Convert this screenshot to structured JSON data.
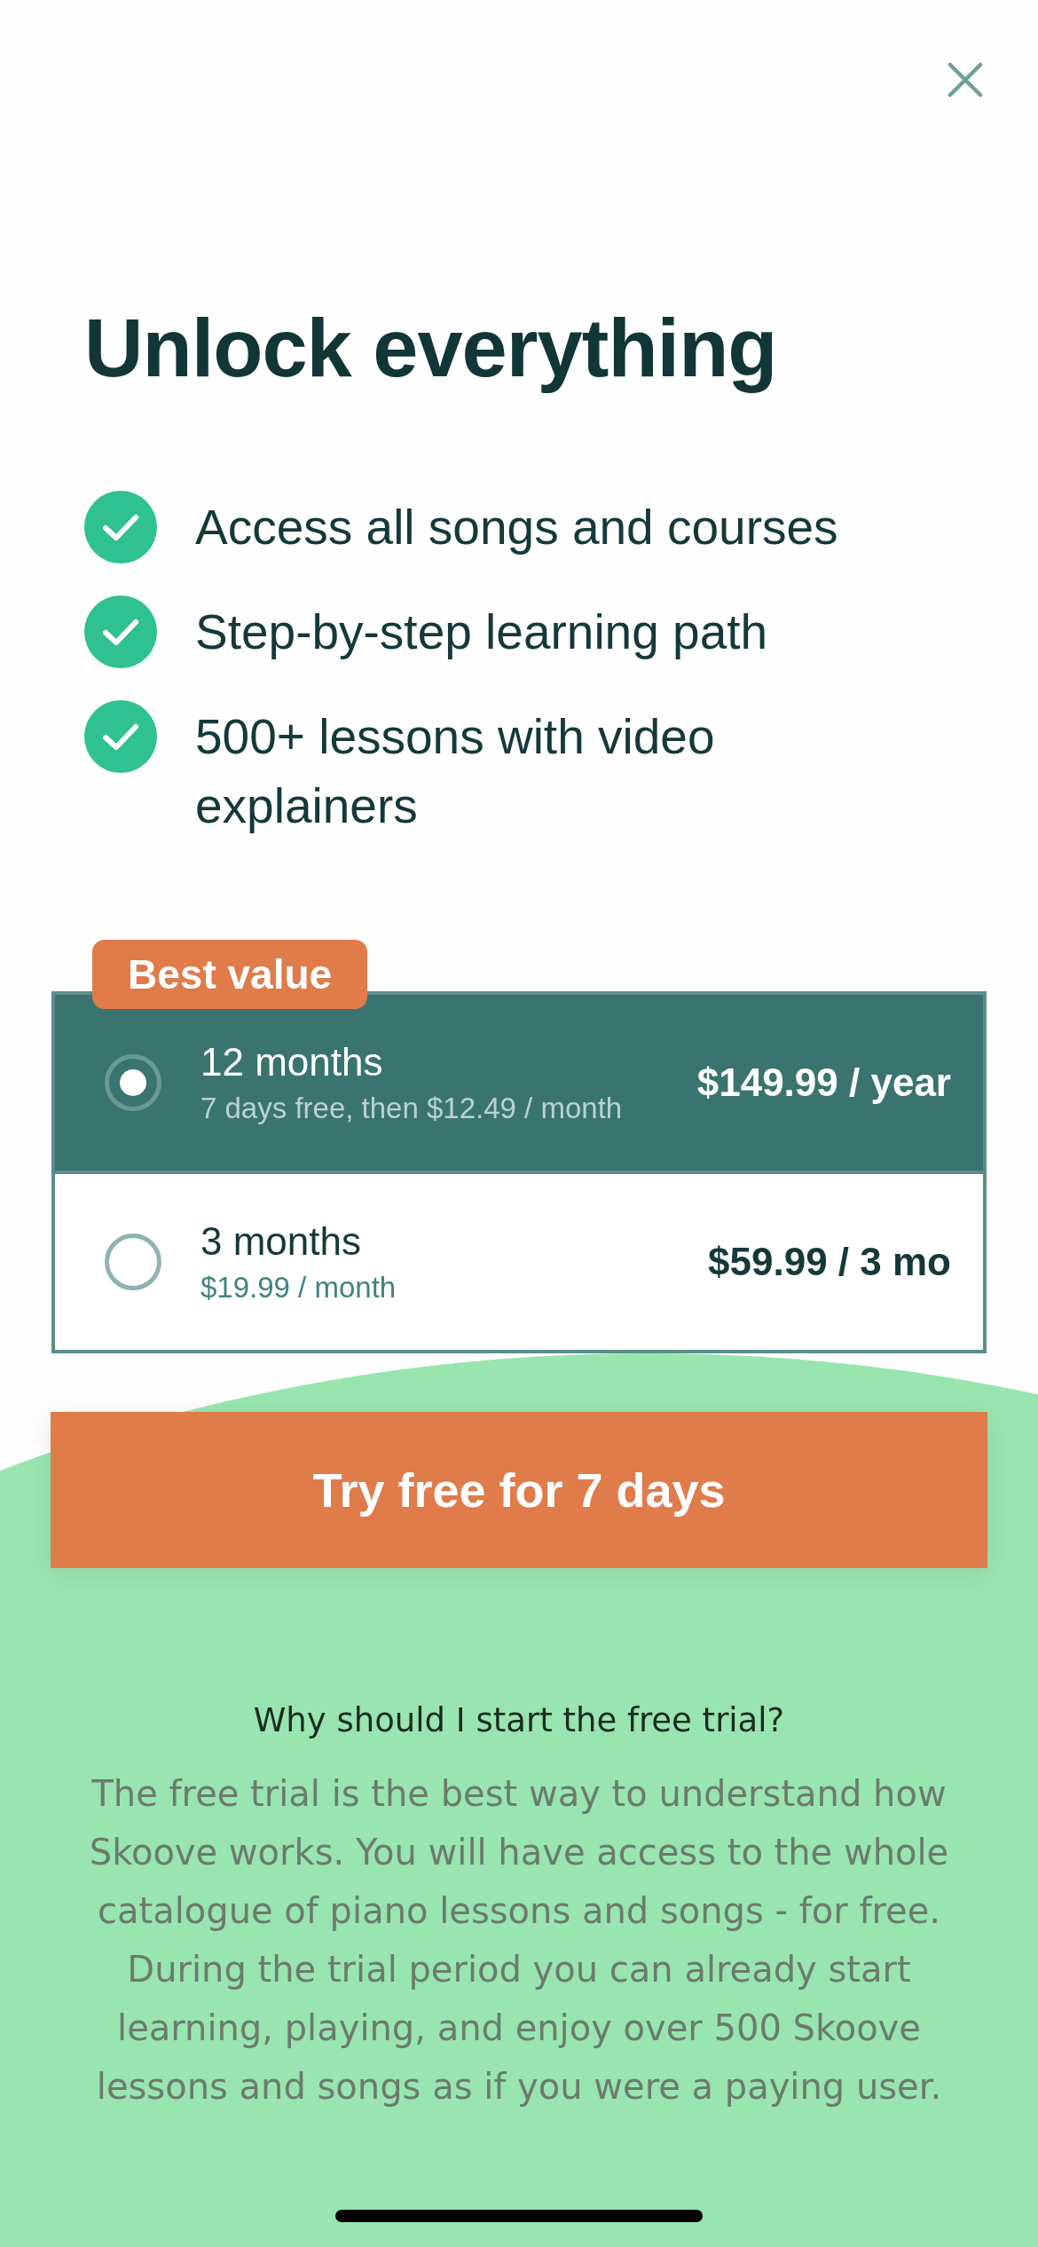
{
  "title": "Unlock everything",
  "features": [
    "Access all songs and courses",
    "Step-by-step learning path",
    "500+ lessons with video explainers"
  ],
  "plans": [
    {
      "badge": "Best value",
      "name": "12 months",
      "detail": "7 days free, then $12.49 / month",
      "price": "$149.99 / year",
      "selected": true
    },
    {
      "name": "3 months",
      "detail": "$19.99 / month",
      "price": "$59.99 / 3 mo",
      "selected": false
    }
  ],
  "cta": "Try free for 7 days",
  "faq": {
    "question": "Why should I start the free trial?",
    "answer": "The free trial is the best way to understand how Skoove works. You will have access to the whole catalogue of piano lessons and songs - for free. During the trial period you can already start learning, playing, and enjoy over 500 Skoove lessons and songs as if you were a paying user."
  }
}
